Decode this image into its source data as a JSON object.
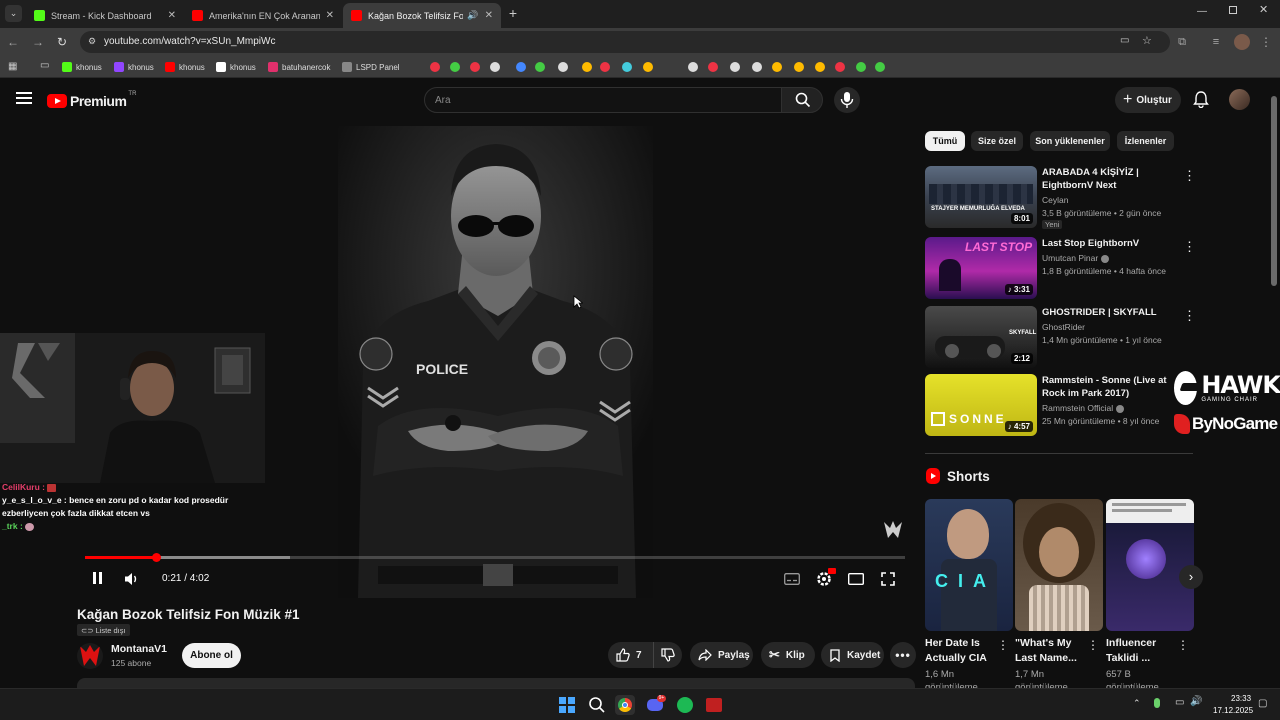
{
  "browser": {
    "tabs": [
      {
        "title": "Stream - Kick Dashboard",
        "color": "#53fc18"
      },
      {
        "title": "Amerika'nın EN Çok Aranan Sür",
        "color": "#ff0000"
      },
      {
        "title": "Kağan Bozok Telifsiz Fon M",
        "color": "#ff0000"
      }
    ],
    "url": "youtube.com/watch?v=xSUn_MmpiWc",
    "bookmarks": [
      {
        "label": "khonus",
        "color": "#53fc18"
      },
      {
        "label": "khonus",
        "color": "#9146ff"
      },
      {
        "label": "khonus",
        "color": "#ff0000"
      },
      {
        "label": "khonus",
        "color": "#ffffff"
      },
      {
        "label": "batuhanercok",
        "color": "#e1306c"
      },
      {
        "label": "LSPD Panel",
        "color": "#888888"
      }
    ]
  },
  "youtube": {
    "logo_text": "Premium",
    "logo_sup": "TR",
    "search_placeholder": "Ara",
    "create_label": "Oluştur",
    "filters": [
      "Tümü",
      "Size özel",
      "Son yüklenenler",
      "İzlenenler"
    ],
    "player": {
      "time": "0:21 / 4:02",
      "progress": 0.087,
      "buffered": 0.25,
      "chat": [
        {
          "user": "CelilKuru :",
          "msg": ""
        },
        {
          "user": "y_e_s_l_o_v_e :",
          "msg": "bence en zoru pd o kadar kod prosedür ezberliycen çok fazla dikkat etcen vs"
        },
        {
          "user": "_trk :",
          "msg": ""
        }
      ],
      "police_text": "POLICE"
    },
    "video": {
      "title": "Kağan Bozok Telifsiz Fon Müzik #1",
      "badge": "Liste dışı",
      "channel": "MontanaV1",
      "subs": "125 abone",
      "subscribe_label": "Abone ol",
      "likes": "7",
      "share_label": "Paylaş",
      "clip_label": "Klip",
      "save_label": "Kaydet"
    },
    "recommendations": [
      {
        "title": "ARABADA 4 KİŞİYİZ | EightbornV Next",
        "channel": "Ceylan",
        "meta": "3,5 B görüntüleme • 2 gün önce",
        "duration": "8:01",
        "badge": "Yeni",
        "thumb_text": "STAJYER MEMURLUĞA ELVEDA"
      },
      {
        "title": "Last Stop EightbornV",
        "channel": "Umutcan Pinar",
        "meta": "1,8 B görüntüleme • 4 hafta önce",
        "duration": "3:31",
        "thumb_text": "LAST STOP"
      },
      {
        "title": "GHOSTRIDER | SKYFALL",
        "channel": "GhostRider",
        "meta": "1,4 Mn görüntüleme • 1 yıl önce",
        "duration": "2:12",
        "thumb_text": "SKYFALL"
      },
      {
        "title": "Rammstein - Sonne (Live at Rock im Park 2017)",
        "channel": "Rammstein Official",
        "meta": "25 Mn görüntüleme • 8 yıl önce",
        "duration": "4:57",
        "thumb_text": "SONNE"
      }
    ],
    "shorts_label": "Shorts",
    "shorts": [
      {
        "title": "Her Date Is Actually CIA",
        "views": "1,6 Mn",
        "views2": "görüntüleme"
      },
      {
        "title": "\"What's My Last Name...",
        "views": "1,7 Mn",
        "views2": "görüntüleme"
      },
      {
        "title": "Influencer Taklidi ...",
        "views": "657 B",
        "views2": "görüntüleme"
      }
    ],
    "overlay_brand_1": "HAWK",
    "overlay_brand_1_sub": "GAMING CHAIR",
    "overlay_brand_2": "ByNoGame"
  },
  "taskbar": {
    "time": "23:33",
    "date": "17.12.2025"
  }
}
